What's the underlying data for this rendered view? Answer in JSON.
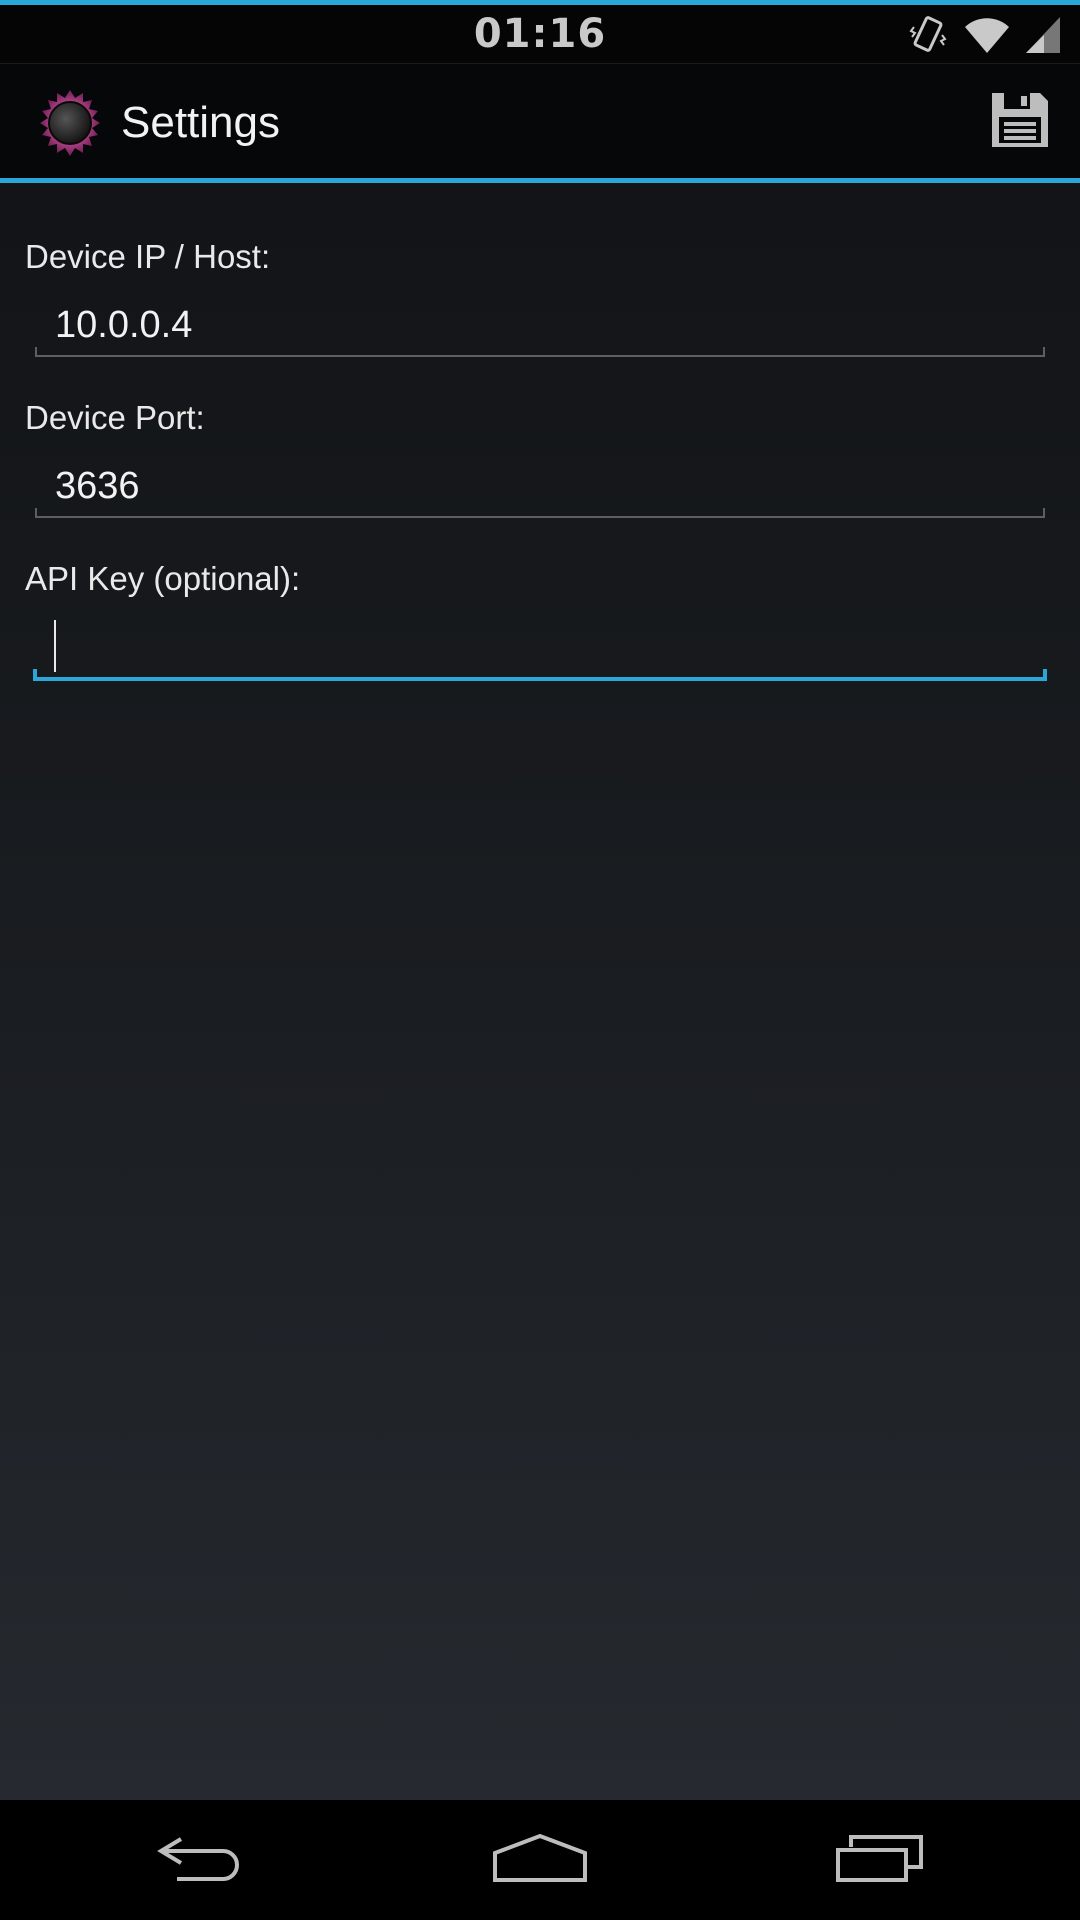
{
  "status_bar": {
    "time": "01:16",
    "icons": [
      "vibrate-icon",
      "wifi-icon",
      "signal-icon"
    ]
  },
  "action_bar": {
    "title": "Settings",
    "app_icon": "app-logo-icon",
    "save_icon": "save-floppy-icon"
  },
  "form": {
    "host": {
      "label": "Device IP / Host:",
      "value": "10.0.0.4"
    },
    "port": {
      "label": "Device Port:",
      "value": "3636"
    },
    "api_key": {
      "label": "API Key (optional):",
      "value": ""
    }
  },
  "nav_bar": {
    "icons": [
      "back-icon",
      "home-icon",
      "recents-icon"
    ]
  },
  "colors": {
    "accent": "#2aa7d8",
    "background_top": "#121417",
    "background_bottom": "#262a30",
    "text": "#e9e9e9"
  }
}
